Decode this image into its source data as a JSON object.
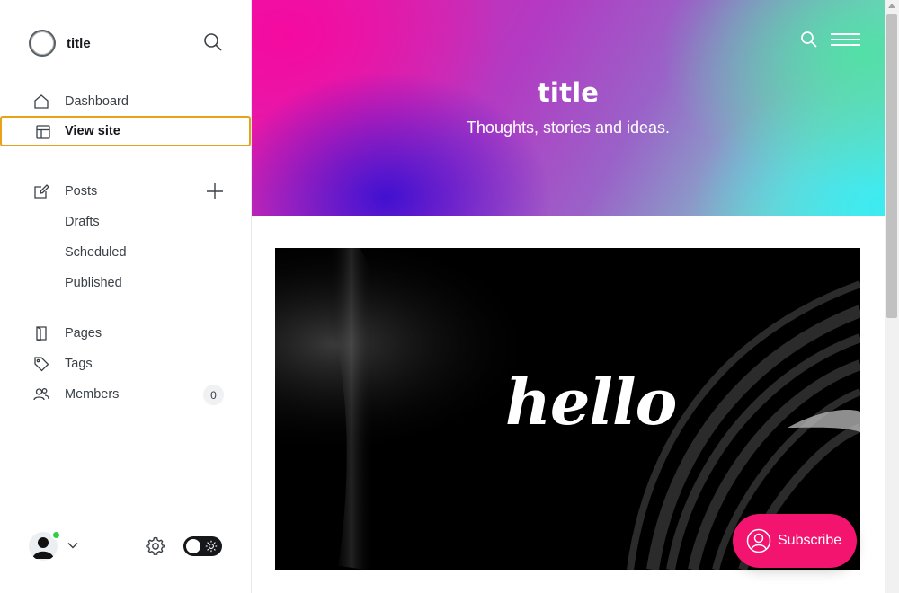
{
  "sidebar": {
    "brand_title": "title",
    "nav": {
      "dashboard": "Dashboard",
      "view_site": "View site",
      "posts": "Posts",
      "drafts": "Drafts",
      "scheduled": "Scheduled",
      "published": "Published",
      "pages": "Pages",
      "tags": "Tags",
      "members": "Members",
      "members_count": "0"
    },
    "icons": [
      "search-icon",
      "home-icon",
      "layout-icon",
      "edit-icon",
      "plus-icon",
      "page-icon",
      "tag-icon",
      "members-icon",
      "chevron-down-icon",
      "gear-icon",
      "sun-icon"
    ],
    "accent_color": "#e8a21a",
    "online_color": "#30cf43"
  },
  "site": {
    "title": "title",
    "description": "Thoughts, stories and ideas.",
    "feature_text": "hello",
    "subscribe_label": "Subscribe",
    "subscribe_color": "#f2146f"
  }
}
